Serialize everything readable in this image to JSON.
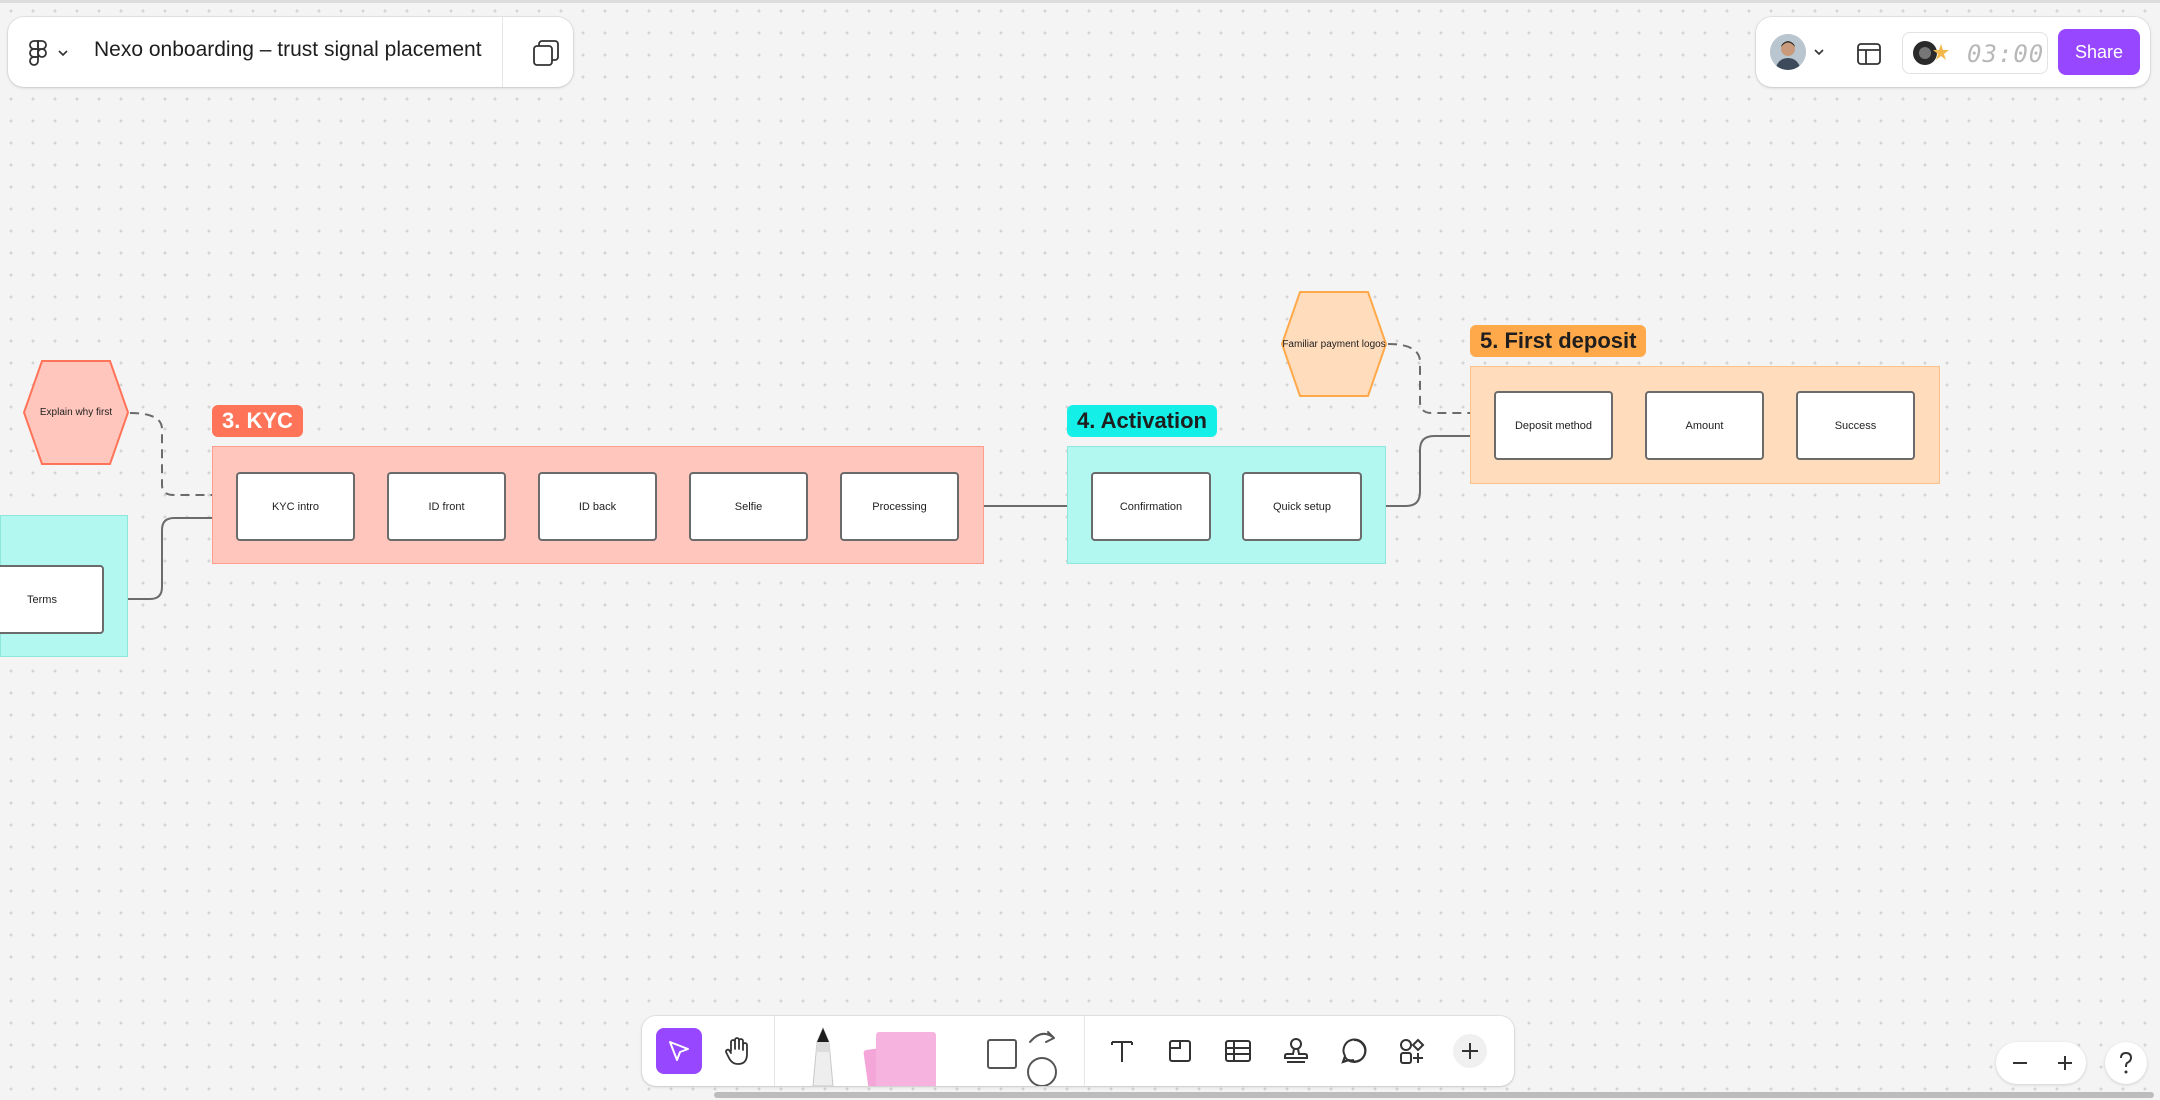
{
  "file": {
    "title": "Nexo onboarding – trust signal placement"
  },
  "header_right": {
    "timer": "03:00",
    "share_label": "Share"
  },
  "canvas": {
    "sections": [
      {
        "id": "kyc",
        "label": "3. KYC",
        "label_color": "#ff7458",
        "label_text_color": "#ffffff",
        "bg_color": "#ffc6bd"
      },
      {
        "id": "activation",
        "label": "4. Activation",
        "label_color": "#14f0e8",
        "label_text_color": "#1e1e1e",
        "bg_color": "#b2f8f0"
      },
      {
        "id": "first-deposit",
        "label": "5. First deposit",
        "label_color": "#ffa94a",
        "label_text_color": "#1e1e1e",
        "bg_color": "#ffdcbc"
      }
    ],
    "prev_section": {
      "bg_color": "#b2f8f0",
      "steps": [
        "Terms"
      ]
    },
    "kyc_steps": [
      "KYC intro",
      "ID front",
      "ID back",
      "Selfie",
      "Processing"
    ],
    "activation_steps": [
      "Confirmation",
      "Quick setup"
    ],
    "deposit_steps": [
      "Deposit method",
      "Amount",
      "Success"
    ],
    "trust_signals": [
      {
        "id": "explain-why-first",
        "label": "Explain why first",
        "fill": "#ffc6bd",
        "stroke": "#ff7458"
      },
      {
        "id": "familiar-payment-logos",
        "label": "Familiar payment logos",
        "fill": "#ffdcbc",
        "stroke": "#ffa94a"
      }
    ]
  },
  "colors": {
    "accent": "#9747ff",
    "connector": "#6b6b6b"
  },
  "icons": {
    "menu": "figma-logo-icon",
    "pages": "pages-icon",
    "layout": "layout-icon",
    "timer": "timer-icon",
    "move": "cursor-icon",
    "hand": "hand-icon",
    "pen": "pen-icon",
    "sticky": "sticky-note-icon",
    "shapes": "shapes-icon",
    "text": "text-icon",
    "section": "section-icon",
    "table": "table-icon",
    "stamp": "stamp-icon",
    "comment": "comment-icon",
    "widgets": "widgets-icon",
    "more": "plus-icon"
  }
}
